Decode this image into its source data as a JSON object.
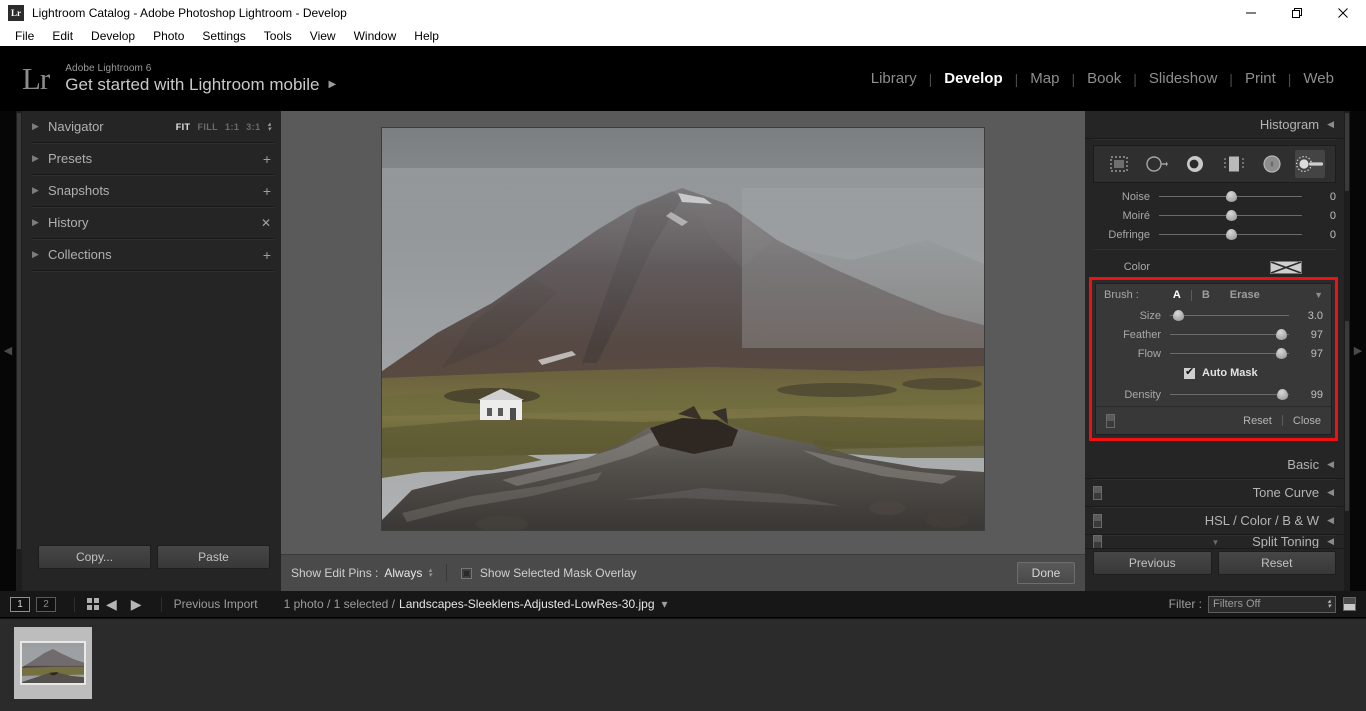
{
  "window": {
    "app_icon": "Lr",
    "title": "Lightroom Catalog - Adobe Photoshop Lightroom - Develop",
    "minimize": "—",
    "restore": "❐",
    "close": "✕"
  },
  "menubar": {
    "items": [
      "File",
      "Edit",
      "Develop",
      "Photo",
      "Settings",
      "Tools",
      "View",
      "Window",
      "Help"
    ]
  },
  "identity": {
    "logo": "Lr",
    "product": "Adobe Lightroom 6",
    "tagline": "Get started with Lightroom mobile",
    "tagline_arrow": "▶"
  },
  "modules": {
    "items": [
      "Library",
      "Develop",
      "Map",
      "Book",
      "Slideshow",
      "Print",
      "Web"
    ],
    "active": "Develop",
    "separator": "|"
  },
  "left_panel": {
    "rows": [
      {
        "label": "Navigator",
        "triangle": "▶",
        "kind": "navigator"
      },
      {
        "label": "Presets",
        "triangle": "▶",
        "kind": "plus",
        "action": "+"
      },
      {
        "label": "Snapshots",
        "triangle": "▶",
        "kind": "plus",
        "action": "+"
      },
      {
        "label": "History",
        "triangle": "▶",
        "kind": "close",
        "action": "✕"
      },
      {
        "label": "Collections",
        "triangle": "▶",
        "kind": "plus",
        "action": "+"
      }
    ],
    "zoom_options": [
      {
        "label": "FIT",
        "active": true
      },
      {
        "label": "FILL",
        "active": false
      },
      {
        "label": "1:1",
        "active": false
      },
      {
        "label": "3:1",
        "active": false
      }
    ],
    "buttons": {
      "copy": "Copy...",
      "paste": "Paste"
    }
  },
  "edges": {
    "left_arrow": "◀",
    "right_arrow": "▶",
    "top_arrow": "▲"
  },
  "center_toolbar": {
    "show_edit_pins_label": "Show Edit Pins :",
    "show_edit_pins_value": "Always",
    "mask_overlay_label": "Show Selected Mask Overlay",
    "mask_overlay_checked": false,
    "done_label": "Done"
  },
  "right_panel": {
    "histogram_title": "Histogram",
    "tools": [
      {
        "name": "crop-overlay-tool",
        "selected": false
      },
      {
        "name": "spot-removal-tool",
        "selected": false
      },
      {
        "name": "red-eye-correction-tool",
        "selected": false
      },
      {
        "name": "graduated-filter-tool",
        "selected": false
      },
      {
        "name": "radial-filter-tool",
        "selected": false
      },
      {
        "name": "adjustment-brush-tool",
        "selected": true
      }
    ],
    "sliders_top": [
      {
        "label": "Noise",
        "value": "0",
        "pos": 50
      },
      {
        "label": "Moiré",
        "value": "0",
        "pos": 50
      },
      {
        "label": "Defringe",
        "value": "0",
        "pos": 50
      }
    ],
    "color_row": {
      "label": "Color",
      "swatch": "none"
    },
    "brush": {
      "label": "Brush :",
      "modes": [
        {
          "label": "A",
          "active": true
        },
        {
          "label": "B",
          "active": false
        },
        {
          "label": "Erase",
          "active": false
        }
      ],
      "collapse_triangle": "▼",
      "sliders": [
        {
          "label": "Size",
          "value": "3.0",
          "pos": 7
        },
        {
          "label": "Feather",
          "value": "97",
          "pos": 93
        },
        {
          "label": "Flow",
          "value": "97",
          "pos": 93
        }
      ],
      "auto_mask": {
        "label": "Auto Mask",
        "checked": true
      },
      "density": {
        "label": "Density",
        "value": "99",
        "pos": 94
      },
      "footer": {
        "reset": "Reset",
        "close": "Close",
        "separator": "|"
      }
    },
    "sections": [
      {
        "label": "Basic",
        "triangle": "◀",
        "toggle": false
      },
      {
        "label": "Tone Curve",
        "triangle": "◀",
        "toggle": true
      },
      {
        "label": "HSL  /  Color  /  B & W",
        "triangle": "◀",
        "toggle": true
      },
      {
        "label": "Split Toning",
        "triangle": "◀",
        "toggle": true
      }
    ],
    "overflow_arrow": "▼",
    "buttons": {
      "previous": "Previous",
      "reset": "Reset"
    }
  },
  "filmstrip_bar": {
    "page1": "1",
    "page2": "2",
    "grid_icon": "grid-view-icon",
    "back_arrow": "◀",
    "forward_arrow": "▶",
    "source": "Previous Import",
    "selection": "1 photo / 1 selected /",
    "filename": "Landscapes-Sleeklens-Adjusted-LowRes-30.jpg",
    "filename_caret": "▾",
    "filter_label": "Filter :",
    "filter_value": "Filters Off"
  },
  "colors": {
    "highlight_box": "#ee1111",
    "panel_bg": "#252525",
    "canvas_bg": "#5a5a5a",
    "accent_text": "#ffffff"
  }
}
